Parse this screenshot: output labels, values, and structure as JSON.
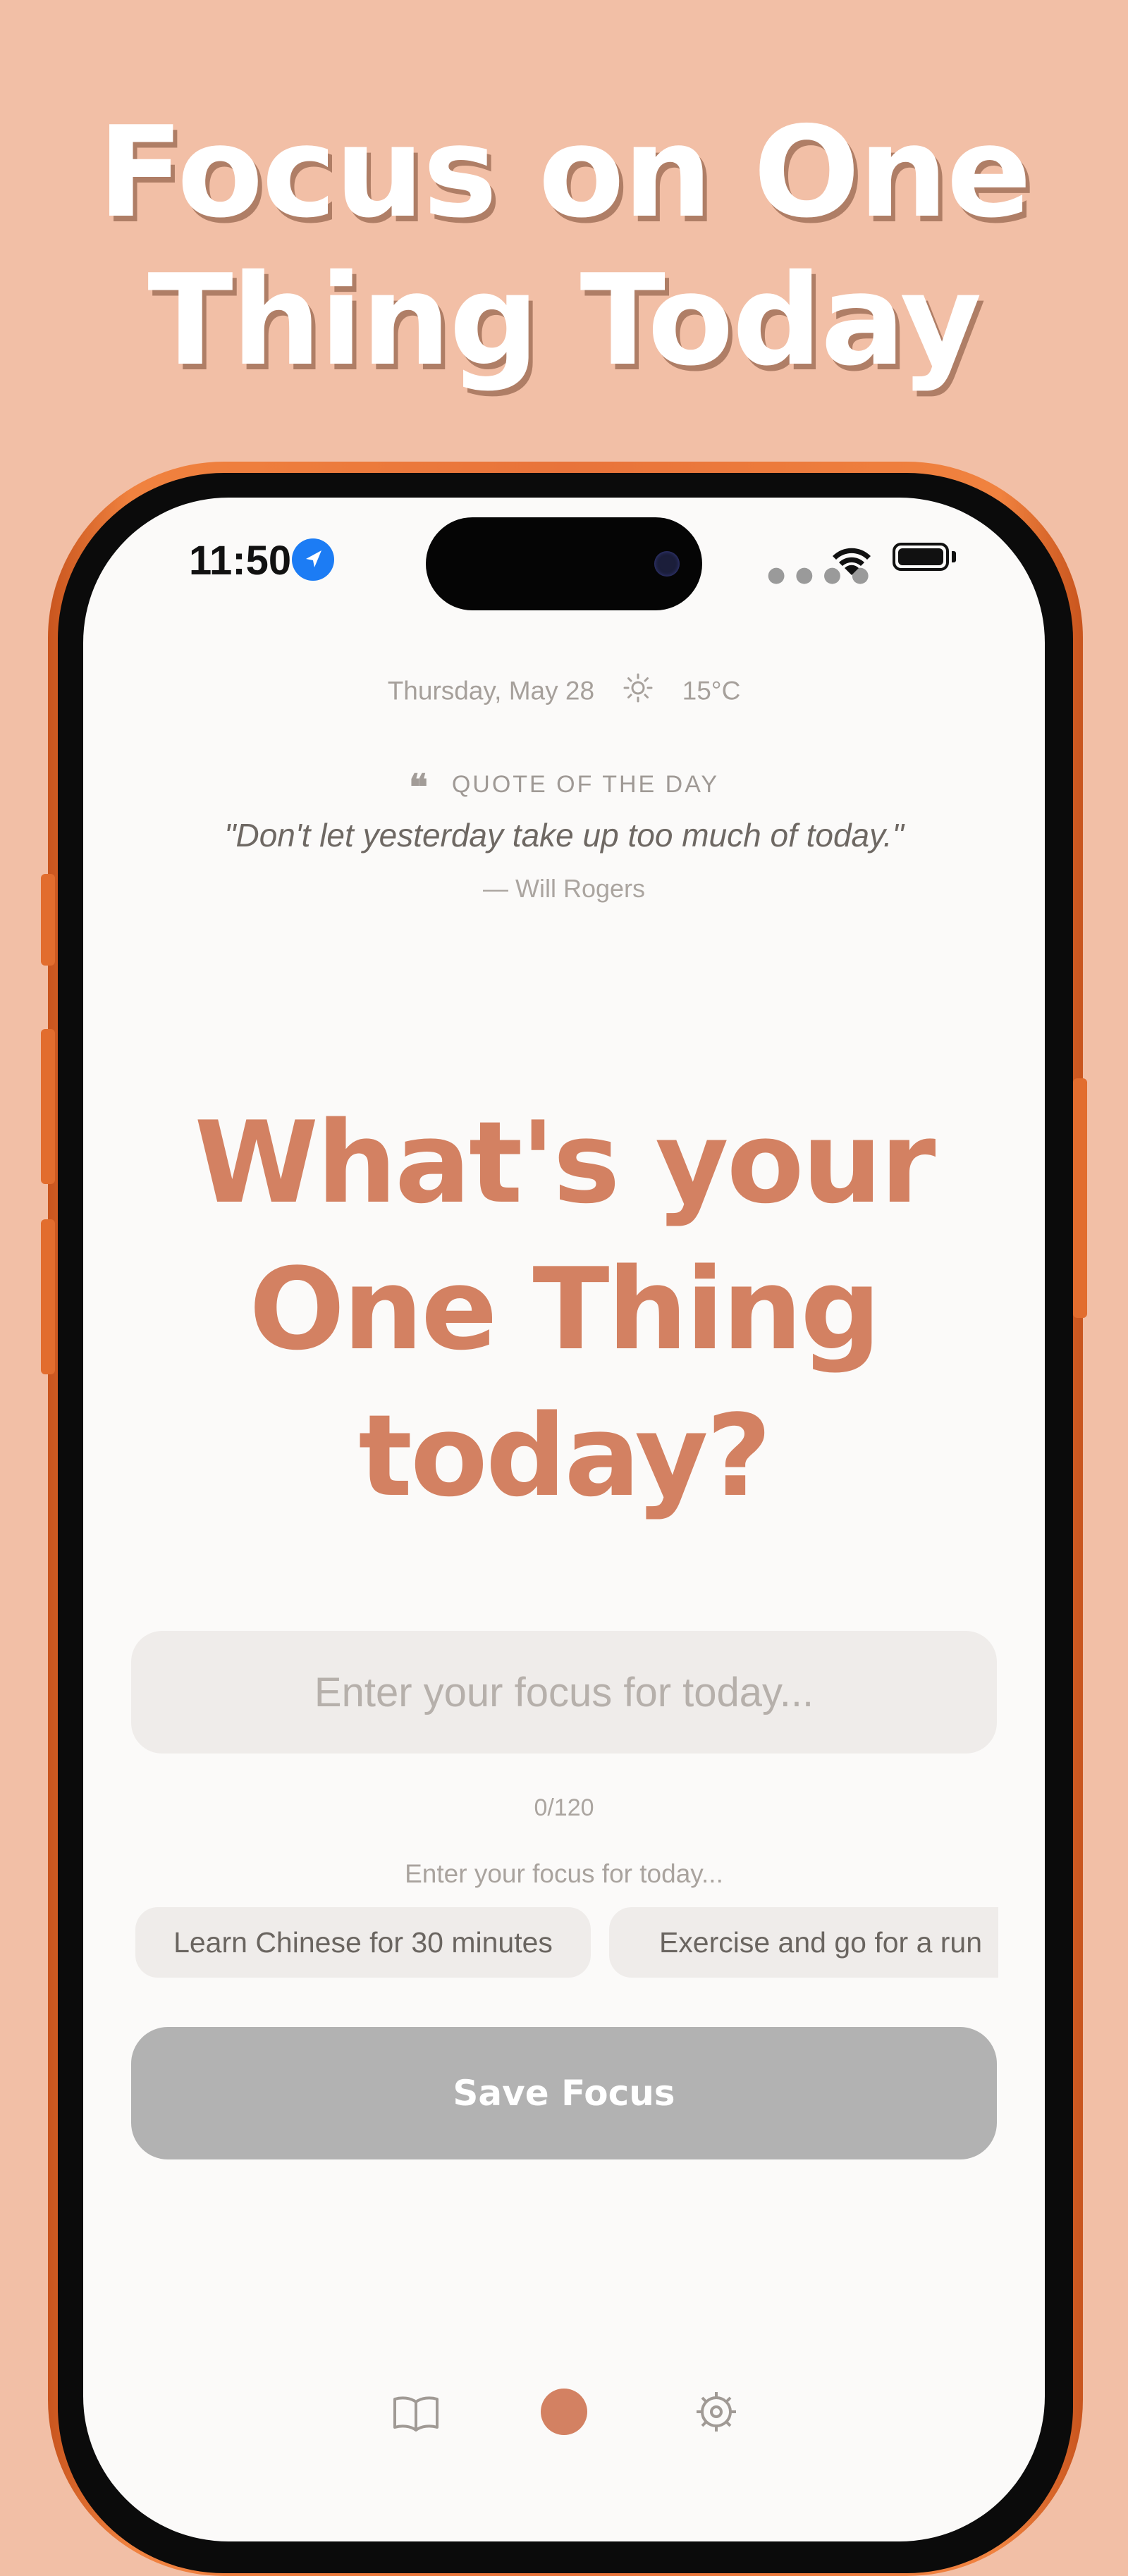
{
  "headline": {
    "line1": "Focus on One",
    "line2": "Thing Today"
  },
  "status_bar": {
    "time": "11:50",
    "icons": [
      "location-arrow-icon",
      "cellular-dots-icon",
      "wifi-icon",
      "battery-icon"
    ]
  },
  "header": {
    "date": "Thursday, May 28",
    "weather_icon": "sun-icon",
    "temperature": "15°C"
  },
  "quote": {
    "label": "QUOTE OF THE DAY",
    "text": "\"Don't let yesterday take up too much of today.\"",
    "author": "— Will Rogers"
  },
  "prompt": {
    "line1": "What's your",
    "line2": "One Thing",
    "line3": "today?"
  },
  "focus_input": {
    "placeholder": "Enter your focus for today...",
    "value": "",
    "char_count": "0/120"
  },
  "suggestions": {
    "hint": "Enter your focus for today...",
    "chips": [
      "Learn Chinese for 30 minutes",
      "Exercise and go for a run"
    ]
  },
  "save_button": {
    "label": "Save Focus"
  },
  "tab_bar": {
    "items": [
      "book-icon",
      "focus-dot-icon",
      "settings-gear-icon"
    ]
  },
  "colors": {
    "background": "#F2BFA6",
    "accent": "#D38162",
    "phone_frame": "#E8733A",
    "button_disabled": "#B2B2B2",
    "input_bg": "#EFECEA"
  }
}
